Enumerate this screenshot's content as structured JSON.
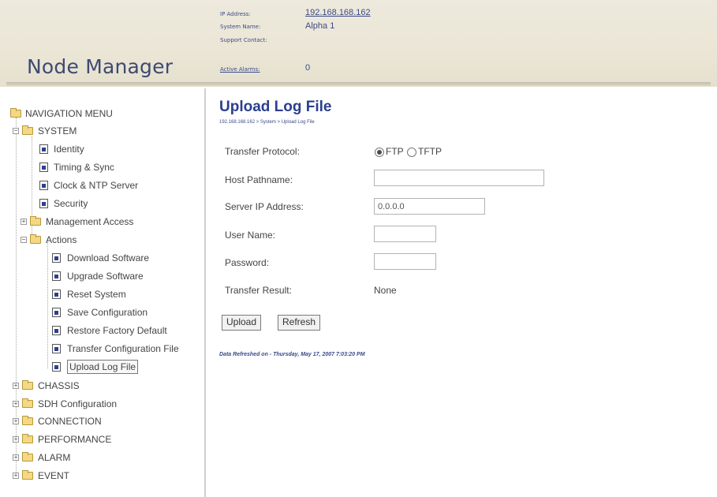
{
  "header": {
    "app_title": "Node Manager",
    "ip_address_label": "IP Address:",
    "ip_address_value": "192.168.168.162",
    "system_name_label": "System Name:",
    "system_name_value": "Alpha 1",
    "support_contact_label": "Support Contact:",
    "support_contact_value": "",
    "active_alarms_label": "Active Alarms:",
    "active_alarms_value": "0"
  },
  "sidebar": {
    "root": "NAVIGATION MENU",
    "system": "SYSTEM",
    "system_items": {
      "identity": "Identity",
      "timing": "Timing & Sync",
      "clock": "Clock & NTP Server",
      "security": "Security",
      "management": "Management Access",
      "actions": "Actions"
    },
    "action_items": {
      "download": "Download Software",
      "upgrade": "Upgrade Software",
      "reset": "Reset System",
      "save": "Save Configuration",
      "restore": "Restore Factory Default",
      "transfer": "Transfer Configuration File",
      "upload_log": "Upload Log File"
    },
    "sections": {
      "chassis": "CHASSIS",
      "sdh": "SDH Configuration",
      "connection": "CONNECTION",
      "performance": "PERFORMANCE",
      "alarm": "ALARM",
      "event": "EVENT"
    }
  },
  "main": {
    "title": "Upload Log File",
    "breadcrumb": "192.168.168.162 > System > Upload Log File",
    "form": {
      "protocol_label": "Transfer Protocol:",
      "protocol_options": [
        "FTP",
        "TFTP"
      ],
      "protocol_selected": "FTP",
      "host_label": "Host Pathname:",
      "host_value": "",
      "server_label": "Server IP Address:",
      "server_value": "0.0.0.0",
      "user_label": "User Name:",
      "user_value": "",
      "password_label": "Password:",
      "password_value": "",
      "result_label": "Transfer Result:",
      "result_value": "None"
    },
    "buttons": {
      "upload": "Upload",
      "refresh": "Refresh"
    },
    "refresh_note": "Data Refreshed on - Thursday, May 17, 2007 7:03:20 PM"
  },
  "colors": {
    "header_bg": "#ebe6d6",
    "title_blue": "#2a3f8e",
    "link_blue": "#3a4a8a"
  }
}
